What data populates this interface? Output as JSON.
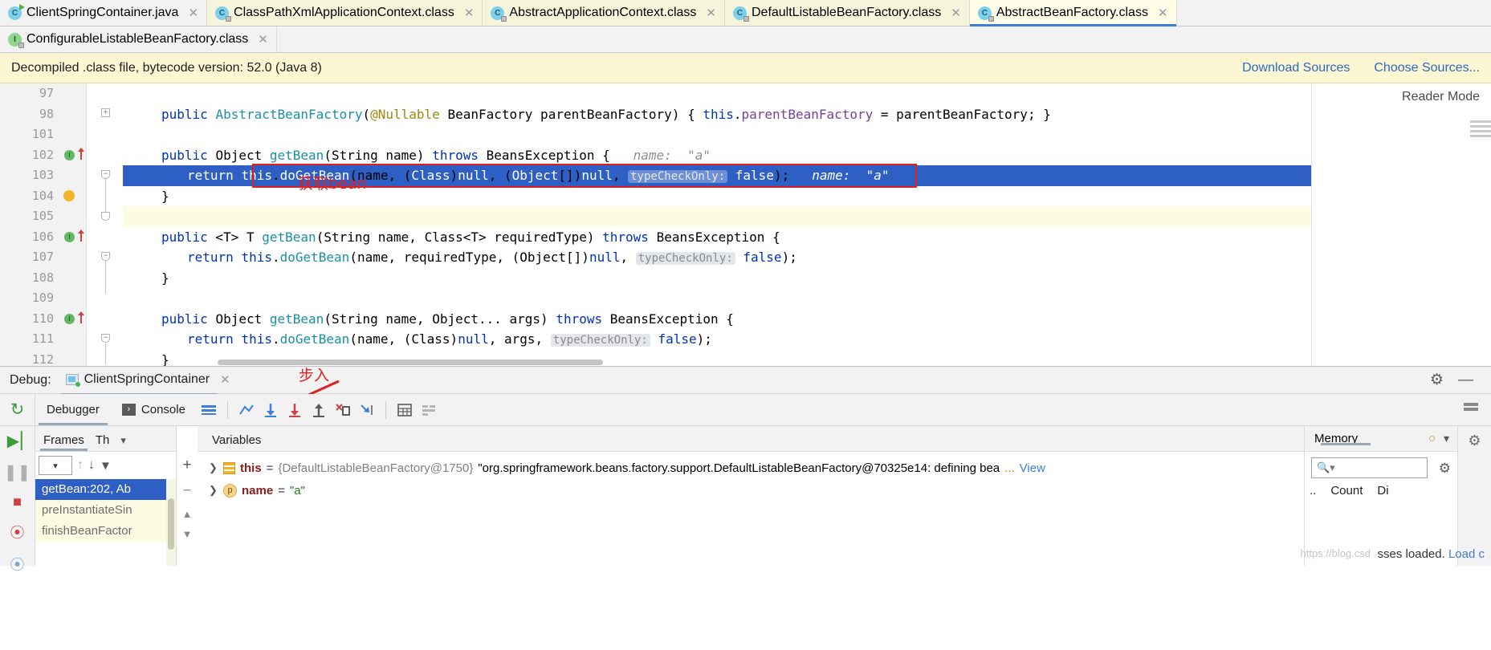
{
  "editor_tabs_row1": [
    {
      "label": "ClientSpringContainer.java",
      "icon": "java-class-run-icon",
      "kind": "java",
      "state": "inactive"
    },
    {
      "label": "ClassPathXmlApplicationContext.class",
      "icon": "class-file-locked-icon",
      "kind": "class",
      "state": "inactive"
    },
    {
      "label": "AbstractApplicationContext.class",
      "icon": "class-file-locked-icon",
      "kind": "class",
      "state": "inactive"
    },
    {
      "label": "DefaultListableBeanFactory.class",
      "icon": "class-file-locked-icon",
      "kind": "class",
      "state": "inactive"
    },
    {
      "label": "AbstractBeanFactory.class",
      "icon": "class-file-locked-icon",
      "kind": "class",
      "state": "active"
    }
  ],
  "editor_tabs_row2": [
    {
      "label": "ConfigurableListableBeanFactory.class",
      "icon": "interface-file-locked-icon",
      "kind": "interface",
      "state": "inactive"
    }
  ],
  "notice": {
    "message": "Decompiled .class file, bytecode version: 52.0 (Java 8)",
    "download_sources": "Download Sources",
    "choose_sources": "Choose Sources..."
  },
  "reader_mode": {
    "label": "Reader Mode"
  },
  "code": {
    "lines": [
      {
        "num": "97",
        "text": "",
        "breakpoint": false,
        "state": "normal"
      },
      {
        "num": "98",
        "text": "    public AbstractBeanFactory(@Nullable BeanFactory parentBeanFactory) { this.parentBeanFactory = parentBeanFactory; }",
        "breakpoint": false,
        "state": "normal"
      },
      {
        "num": "101",
        "text": "",
        "breakpoint": false,
        "state": "normal"
      },
      {
        "num": "102",
        "text": "    public Object getBean(String name) throws BeansException {",
        "hint": "name:  \"a\"",
        "breakpoint": true,
        "state": "normal"
      },
      {
        "num": "103",
        "text": "        return this.doGetBean(name, (Class)null, (Object[])null, typeCheckOnly: false);",
        "hint": "name:  \"a\"",
        "breakpoint": false,
        "state": "current"
      },
      {
        "num": "104",
        "text": "    }",
        "breakpoint": false,
        "state": "normal",
        "bulb": true
      },
      {
        "num": "105",
        "text": "",
        "breakpoint": false,
        "state": "caret"
      },
      {
        "num": "106",
        "text": "    public <T> T getBean(String name, Class<T> requiredType) throws BeansException {",
        "breakpoint": true,
        "state": "normal"
      },
      {
        "num": "107",
        "text": "        return this.doGetBean(name, requiredType, (Object[])null, typeCheckOnly: false);",
        "breakpoint": false,
        "state": "normal"
      },
      {
        "num": "108",
        "text": "    }",
        "breakpoint": false,
        "state": "normal"
      },
      {
        "num": "109",
        "text": "",
        "breakpoint": false,
        "state": "normal"
      },
      {
        "num": "110",
        "text": "    public Object getBean(String name, Object... args) throws BeansException {",
        "breakpoint": true,
        "state": "normal"
      },
      {
        "num": "111",
        "text": "        return this.doGetBean(name, (Class)null, args, typeCheckOnly: false);",
        "breakpoint": false,
        "state": "normal"
      },
      {
        "num": "112",
        "text": "    }",
        "breakpoint": false,
        "state": "normal"
      }
    ]
  },
  "annotations": {
    "get_bean_note": "获取bean",
    "step_into_note": "步入"
  },
  "debug_header": {
    "label": "Debug:",
    "session": "ClientSpringContainer",
    "close_icon": "close-icon",
    "settings_icon": "gear-icon",
    "minimize_icon": "minimize-icon"
  },
  "debug_toolbar": {
    "rerun_icon": "rerun-icon",
    "tabs": [
      {
        "label": "Debugger",
        "selected": true,
        "icon": "debugger-icon"
      },
      {
        "label": "Console",
        "selected": false,
        "icon": "console-icon"
      }
    ],
    "layout_icon": "layout-icon",
    "actions": [
      {
        "name": "show-execution-point-icon",
        "glyph": "⤴"
      },
      {
        "name": "step-over-icon",
        "glyph": "↓"
      },
      {
        "name": "step-into-icon",
        "glyph": "↓"
      },
      {
        "name": "step-out-icon",
        "glyph": "↑"
      },
      {
        "name": "force-step-into-icon",
        "glyph": "✗"
      },
      {
        "name": "run-to-cursor-icon",
        "glyph": "↘"
      },
      {
        "name": "evaluate-expression-icon",
        "glyph": "▦"
      },
      {
        "name": "mute-breakpoints-icon",
        "glyph": "☰"
      }
    ]
  },
  "frames_pane": {
    "tabs": [
      {
        "label": "Frames",
        "selected": true
      },
      {
        "label": "Th",
        "selected": false
      }
    ],
    "dropdown_icon": "chevron-down-icon",
    "toolbar": [
      {
        "name": "thread-selector-combo",
        "glyph": "▾"
      },
      {
        "name": "frames-up-icon",
        "glyph": "↑"
      },
      {
        "name": "frames-down-icon",
        "glyph": "↓"
      },
      {
        "name": "filter-frames-icon",
        "glyph": "▼"
      }
    ],
    "items": [
      {
        "label": "getBean:202, Ab",
        "selected": true
      },
      {
        "label": "preInstantiateSin",
        "selected": false
      },
      {
        "label": "finishBeanFactor",
        "selected": false
      }
    ]
  },
  "variables_pane": {
    "title": "Variables",
    "add_icon": "add-watch-icon",
    "remove_icon": "remove-watch-icon",
    "scroll_up_icon": "scroll-up-icon",
    "scroll_down_icon": "scroll-down-icon",
    "rows": [
      {
        "icon": "field-icon",
        "name": "this",
        "eq": "=",
        "object": "{DefaultListableBeanFactory@1750}",
        "value": "\"org.springframework.beans.factory.support.DefaultListableBeanFactory@70325e14: defining bea",
        "ellipsis": "...",
        "view_link": "View"
      },
      {
        "icon": "parameter-icon",
        "name": "name",
        "eq": "=",
        "object": "",
        "value": "\"a\"",
        "ellipsis": "",
        "view_link": ""
      }
    ]
  },
  "memory_pane": {
    "title": "Memory",
    "load_icon": "load-classes-icon",
    "collapse_icon": "chevron-down-icon",
    "search_placeholder": "",
    "search_icon": "search-icon",
    "settings_icon": "gear-icon",
    "columns": [
      "..",
      "Count",
      "Di"
    ]
  },
  "status_bar": {
    "classes_loaded": "sses loaded.",
    "load_link": "Load c",
    "watermark": "https://blog.csd"
  },
  "colors": {
    "accent_blue": "#2e5fc4",
    "tab_active": "#fffde7",
    "notice_bg": "#fdf6d3",
    "annotation_red": "#e02020",
    "link_blue": "#3c7fd4"
  }
}
